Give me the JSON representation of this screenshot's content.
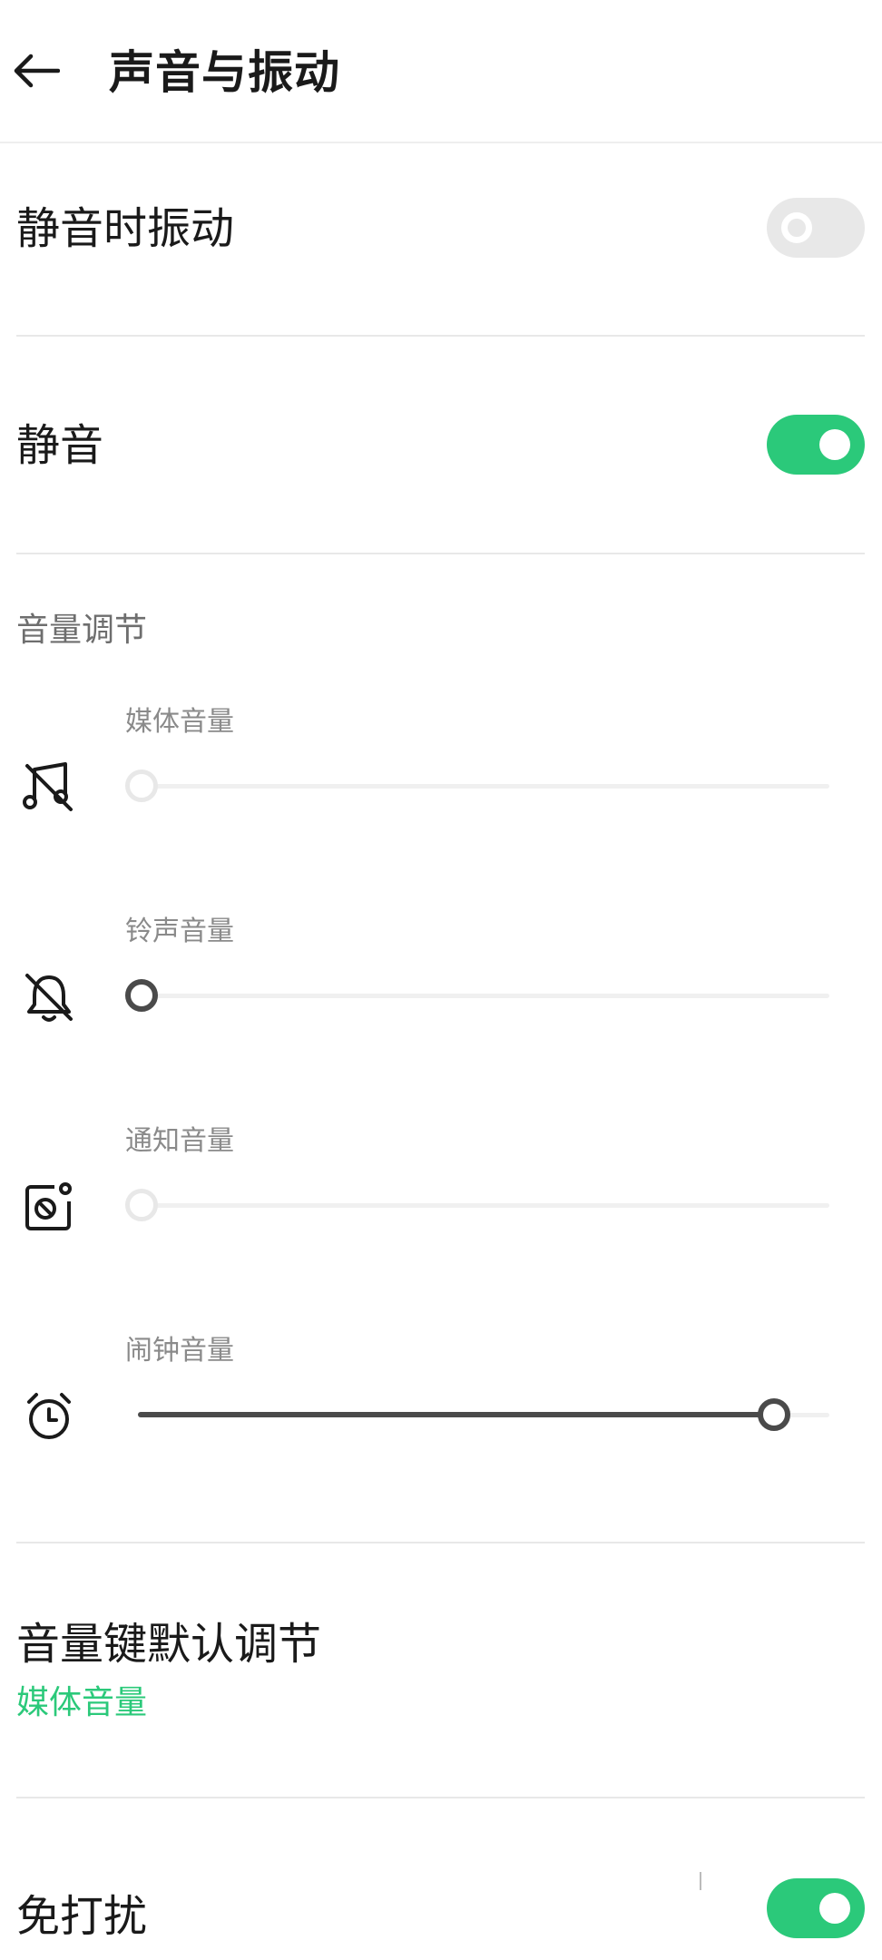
{
  "header": {
    "back_icon": "arrow-left-icon",
    "title": "声音与振动"
  },
  "settings": {
    "vibrate_on_silent": {
      "label": "静音时振动",
      "enabled": false
    },
    "silent": {
      "label": "静音",
      "enabled": true
    },
    "do_not_disturb": {
      "label": "免打扰",
      "enabled": true
    }
  },
  "volume": {
    "section_title": "音量调节",
    "items": [
      {
        "label": "媒体音量",
        "icon": "music-note-muted-icon",
        "level": 0,
        "active": false
      },
      {
        "label": "铃声音量",
        "icon": "bell-muted-icon",
        "level": 0,
        "active": true
      },
      {
        "label": "通知音量",
        "icon": "notification-muted-icon",
        "level": 0,
        "active": false
      },
      {
        "label": "闹钟音量",
        "icon": "alarm-clock-icon",
        "level": 0.92,
        "active": true
      }
    ]
  },
  "volume_key": {
    "label": "音量键默认调节",
    "value": "媒体音量"
  },
  "colors": {
    "accent": "#2bc97a",
    "slider_active": "#4a4a4a",
    "slider_disabled": "#e8e8e8",
    "divider": "#e8e8e8"
  }
}
